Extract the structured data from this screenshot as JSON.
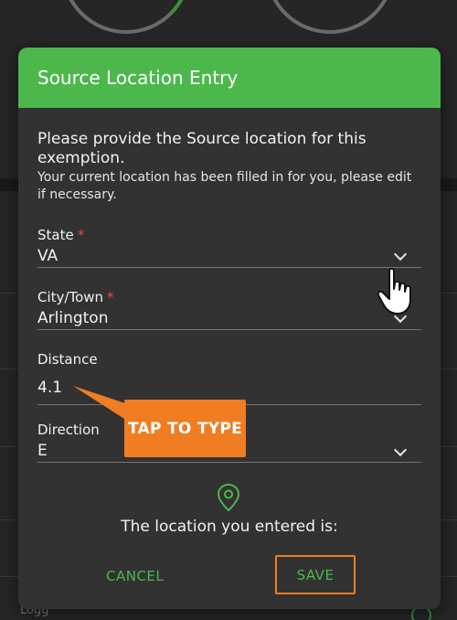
{
  "dialog": {
    "title": "Source Location Entry",
    "intro_main": "Please provide the Source location for this exemption.",
    "intro_sub": "Your current location has been filled in for you, please edit if necessary."
  },
  "fields": {
    "state": {
      "label": "State",
      "required_mark": "*",
      "value": "VA"
    },
    "city": {
      "label": "City/Town",
      "required_mark": "*",
      "value": "Arlington"
    },
    "distance": {
      "label": "Distance",
      "value": "4.1"
    },
    "direction": {
      "label": "Direction",
      "value": "E"
    }
  },
  "location_message": "The location you entered is:",
  "buttons": {
    "cancel": "CANCEL",
    "save": "SAVE"
  },
  "tutorial": {
    "callout": "TAP TO TYPE"
  },
  "background": {
    "footer_text": "Logg"
  },
  "colors": {
    "accent_green": "#4cb84c",
    "highlight_orange": "#f07d22",
    "required_red": "#e84a4a",
    "dialog_bg": "#323232"
  },
  "icons": [
    "location-pin-icon",
    "chevron-down-icon",
    "pointing-hand-icon"
  ]
}
